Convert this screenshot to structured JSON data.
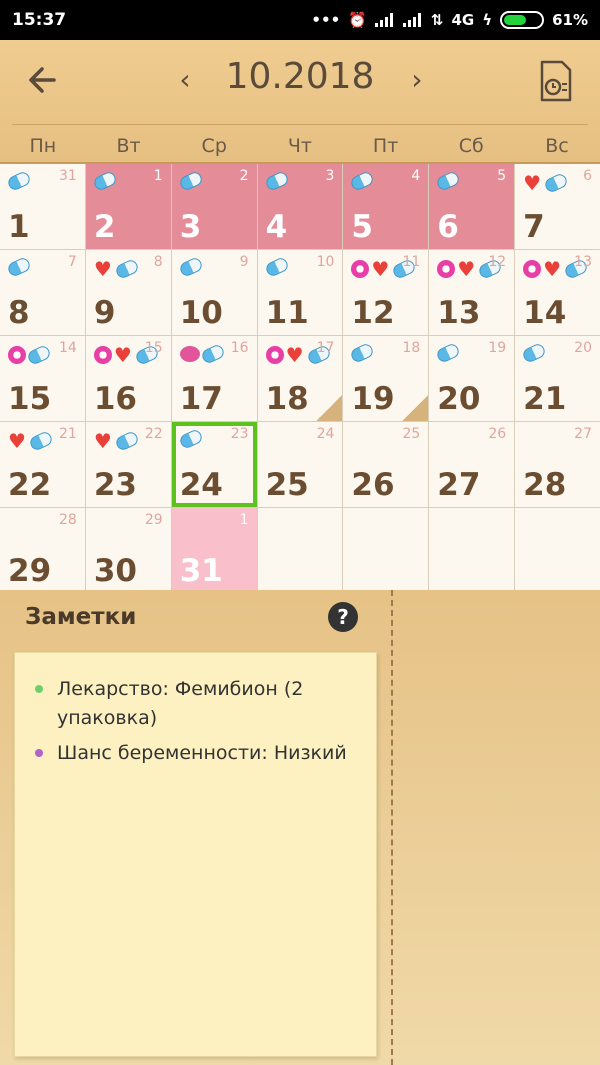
{
  "status_bar": {
    "time": "15:37",
    "network": "4G",
    "battery": "61%"
  },
  "header": {
    "month_title": "10.2018",
    "prev": "‹",
    "next": "›"
  },
  "weekdays": [
    "Пн",
    "Вт",
    "Ср",
    "Чт",
    "Пт",
    "Сб",
    "Вс"
  ],
  "calendar": {
    "days": [
      {
        "day": "1",
        "sub": "31",
        "icons": [
          "pill"
        ],
        "state": ""
      },
      {
        "day": "2",
        "sub": "1",
        "icons": [
          "pill"
        ],
        "state": "period"
      },
      {
        "day": "3",
        "sub": "2",
        "icons": [
          "pill"
        ],
        "state": "period"
      },
      {
        "day": "4",
        "sub": "3",
        "icons": [
          "pill"
        ],
        "state": "period"
      },
      {
        "day": "5",
        "sub": "4",
        "icons": [
          "pill"
        ],
        "state": "period"
      },
      {
        "day": "6",
        "sub": "5",
        "icons": [
          "pill"
        ],
        "state": "period"
      },
      {
        "day": "7",
        "sub": "6",
        "icons": [
          "heart",
          "pill"
        ],
        "state": ""
      },
      {
        "day": "8",
        "sub": "7",
        "icons": [
          "pill"
        ],
        "state": ""
      },
      {
        "day": "9",
        "sub": "8",
        "icons": [
          "heart",
          "pill"
        ],
        "state": ""
      },
      {
        "day": "10",
        "sub": "9",
        "icons": [
          "pill"
        ],
        "state": ""
      },
      {
        "day": "11",
        "sub": "10",
        "icons": [
          "pill"
        ],
        "state": ""
      },
      {
        "day": "12",
        "sub": "11",
        "icons": [
          "flower",
          "heart",
          "pill"
        ],
        "state": ""
      },
      {
        "day": "13",
        "sub": "12",
        "icons": [
          "flower",
          "heart",
          "pill"
        ],
        "state": ""
      },
      {
        "day": "14",
        "sub": "13",
        "icons": [
          "flower",
          "heart",
          "pill"
        ],
        "state": ""
      },
      {
        "day": "15",
        "sub": "14",
        "icons": [
          "flower",
          "pill"
        ],
        "state": ""
      },
      {
        "day": "16",
        "sub": "15",
        "icons": [
          "flower",
          "heart",
          "pill"
        ],
        "state": ""
      },
      {
        "day": "17",
        "sub": "16",
        "icons": [
          "ball",
          "pill"
        ],
        "state": ""
      },
      {
        "day": "18",
        "sub": "17",
        "icons": [
          "flower",
          "heart",
          "pill"
        ],
        "state": "",
        "corner": true
      },
      {
        "day": "19",
        "sub": "18",
        "icons": [
          "pill"
        ],
        "state": "",
        "corner": true
      },
      {
        "day": "20",
        "sub": "19",
        "icons": [
          "pill"
        ],
        "state": ""
      },
      {
        "day": "21",
        "sub": "20",
        "icons": [
          "pill"
        ],
        "state": ""
      },
      {
        "day": "22",
        "sub": "21",
        "icons": [
          "heart",
          "pill"
        ],
        "state": ""
      },
      {
        "day": "23",
        "sub": "22",
        "icons": [
          "heart",
          "pill"
        ],
        "state": ""
      },
      {
        "day": "24",
        "sub": "23",
        "icons": [
          "pill"
        ],
        "state": "today"
      },
      {
        "day": "25",
        "sub": "24",
        "icons": [],
        "state": ""
      },
      {
        "day": "26",
        "sub": "25",
        "icons": [],
        "state": ""
      },
      {
        "day": "27",
        "sub": "26",
        "icons": [],
        "state": ""
      },
      {
        "day": "28",
        "sub": "27",
        "icons": [],
        "state": ""
      },
      {
        "day": "29",
        "sub": "28",
        "icons": [],
        "state": ""
      },
      {
        "day": "30",
        "sub": "29",
        "icons": [],
        "state": ""
      },
      {
        "day": "31",
        "sub": "1",
        "icons": [],
        "state": "predict"
      },
      {
        "day": "",
        "sub": "",
        "icons": [],
        "state": ""
      },
      {
        "day": "",
        "sub": "",
        "icons": [],
        "state": ""
      },
      {
        "day": "",
        "sub": "",
        "icons": [],
        "state": ""
      },
      {
        "day": "",
        "sub": "",
        "icons": [],
        "state": ""
      }
    ]
  },
  "notes": {
    "title": "Заметки",
    "help": "?",
    "items": [
      {
        "text": "Лекарство:  Фемибион (2 упаковка)",
        "color": "#6fcf6a"
      },
      {
        "text": "Шанс беременности: Низкий",
        "color": "#b063c9"
      }
    ]
  }
}
